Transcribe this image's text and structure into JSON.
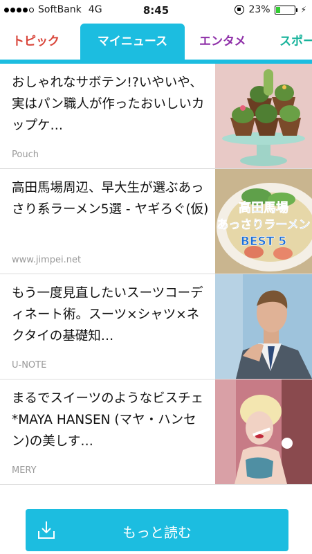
{
  "status_bar": {
    "carrier": "SoftBank",
    "network": "4G",
    "time": "8:45",
    "battery": "23%",
    "battery_level": 0.23
  },
  "tabs": [
    {
      "label": "トピック",
      "color": "#d9453a",
      "active": false
    },
    {
      "label": "マイニュース",
      "color": "#ffffff",
      "active": true
    },
    {
      "label": "エンタメ",
      "color": "#8e2fa8",
      "active": false
    },
    {
      "label": "スポー",
      "color": "#17b39b",
      "active": false
    }
  ],
  "accent_color": "#1cbde0",
  "articles": [
    {
      "title": "おしゃれなサボテン!?いやいや、実はパン職人が作ったおいしいカップケ…",
      "source": "Pouch",
      "thumbnail": "cactus-cupcakes-image"
    },
    {
      "title": "高田馬場周辺、早大生が選ぶあっさり系ラーメン5選 - ヤギろぐ(仮)",
      "source": "www.jimpei.net",
      "thumbnail": "ramen-image",
      "thumbnail_text": [
        "高田馬場",
        "あっさりラーメン",
        "BEST 5"
      ]
    },
    {
      "title": "もう一度見直したいスーツコーディネート術。スーツ×シャツ×ネクタイの基礎知…",
      "source": "U-NOTE",
      "thumbnail": "suit-man-image"
    },
    {
      "title": "まるでスイーツのようなビスチェ*MAYA HANSEN (マヤ・ハンセン)の美しす…",
      "source": "MERY",
      "thumbnail": "pinup-woman-image"
    }
  ],
  "more_button": {
    "label": "もっと読む",
    "icon": "download-icon"
  }
}
